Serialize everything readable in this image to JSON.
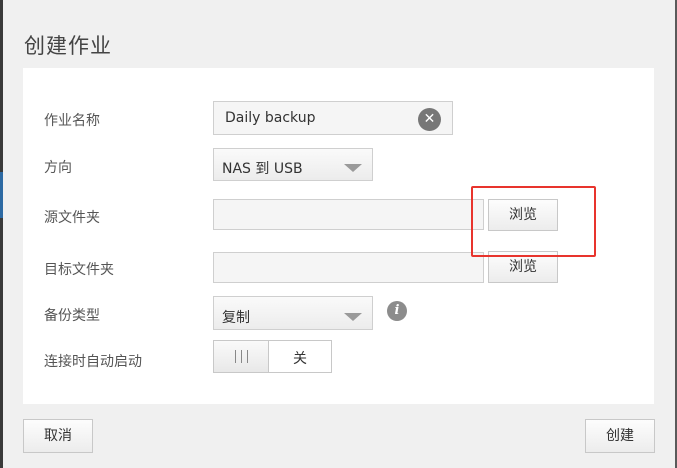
{
  "dialog": {
    "title": "创建作业"
  },
  "form": {
    "job_name": {
      "label": "作业名称",
      "value": "Daily backup"
    },
    "direction": {
      "label": "方向",
      "value": "NAS 到 USB"
    },
    "source_folder": {
      "label": "源文件夹",
      "value": "",
      "browse_label": "浏览"
    },
    "target_folder": {
      "label": "目标文件夹",
      "value": "",
      "browse_label": "浏览"
    },
    "backup_type": {
      "label": "备份类型",
      "value": "复制"
    },
    "auto_start": {
      "label": "连接时自动启动",
      "state_label": "关",
      "on": false
    }
  },
  "footer": {
    "cancel_label": "取消",
    "create_label": "创建"
  },
  "icons": {
    "clear": "close-circle-icon",
    "dropdown": "chevron-down-icon",
    "info": "info-icon"
  },
  "colors": {
    "highlight": "#e8342d"
  }
}
